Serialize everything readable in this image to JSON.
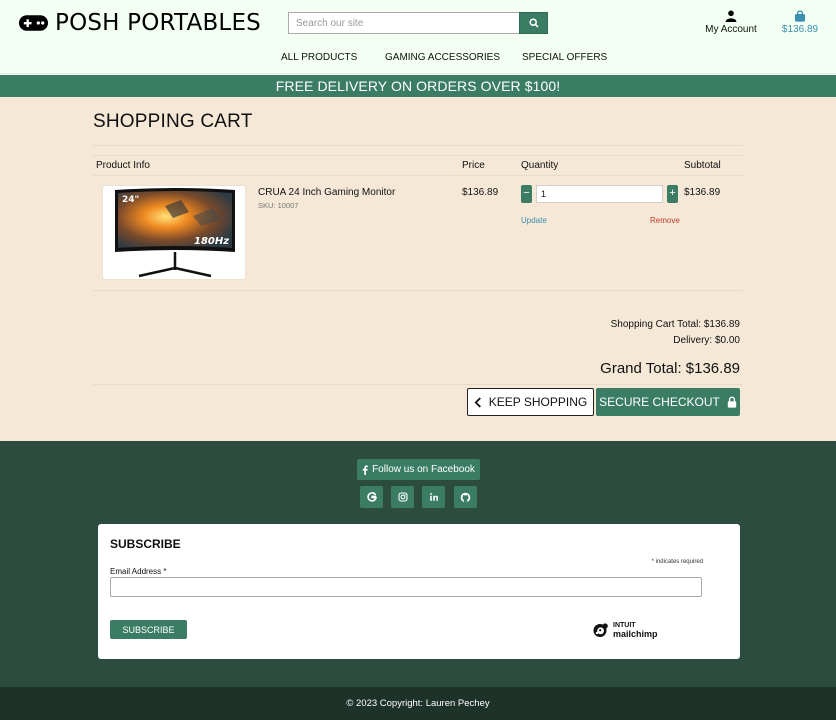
{
  "brand": {
    "name": "POSH PORTABLES",
    "icon": "gamepad-icon"
  },
  "search": {
    "placeholder": "Search our site",
    "icon": "search-icon"
  },
  "account": {
    "label": "My Account",
    "icon": "user-icon"
  },
  "bag": {
    "total": "$136.89",
    "icon": "shopping-bag-icon"
  },
  "nav": {
    "items": [
      "ALL PRODUCTS",
      "GAMING ACCESSORIES",
      "SPECIAL OFFERS"
    ]
  },
  "banner": {
    "text": "FREE DELIVERY ON ORDERS OVER $100!"
  },
  "colors": {
    "accent": "#3b7d64",
    "banner": "#3b7d64",
    "page_bg": "#f5e8d7",
    "footer_bg": "#2b4c3e",
    "copyright_bg": "#1d3229",
    "link_blue": "#3a8fb2",
    "remove_red": "#c0392b"
  },
  "cart": {
    "title": "SHOPPING CART",
    "headers": {
      "product": "Product Info",
      "price": "Price",
      "quantity": "Quantity",
      "subtotal": "Subtotal"
    },
    "items": [
      {
        "name": "CRUA 24 Inch Gaming Monitor",
        "sku": "SKU: 10007",
        "price": "$136.89",
        "quantity": "1",
        "subtotal": "$136.89",
        "update_label": "Update",
        "remove_label": "Remove",
        "image_labels": {
          "size": "24\"",
          "refresh": "180Hz"
        }
      }
    ],
    "cart_total": "Shopping Cart Total: $136.89",
    "delivery": "Delivery: $0.00",
    "grand_total": "Grand Total: $136.89",
    "keep_shopping": "KEEP SHOPPING",
    "checkout": "SECURE CHECKOUT"
  },
  "footer": {
    "facebook": "Follow us on Facebook",
    "social_icons": [
      "google-icon",
      "instagram-icon",
      "linkedin-icon",
      "github-icon"
    ],
    "subscribe": {
      "title": "SUBSCRIBE",
      "required_note": "* indicates required",
      "email_label": "Email Address *",
      "email_value": "",
      "button": "SUBSCRIBE",
      "badge_line1": "INTUIT",
      "badge_line2": "mailchimp"
    },
    "copyright": "© 2023 Copyright: Lauren Pechey"
  }
}
